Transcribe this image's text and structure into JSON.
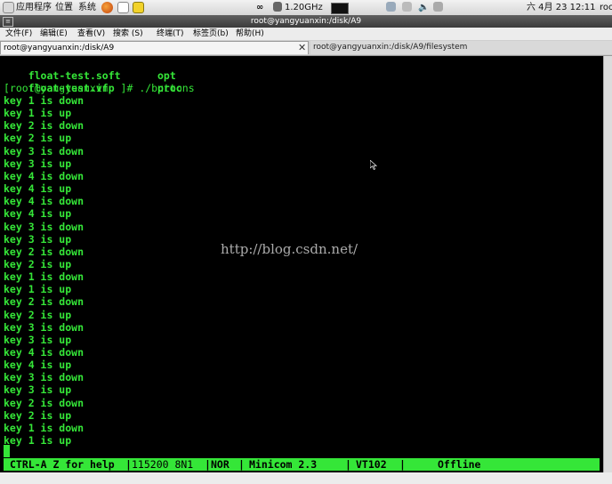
{
  "topbar": {
    "apps": "应用程序",
    "places": "位置",
    "system": "系统",
    "cpu_freq": "1.20GHz",
    "datetime": "六 4月 23 12:11",
    "user": "roo"
  },
  "window": {
    "title": "root@yangyuanxin:/disk/A9"
  },
  "menu": {
    "file": "文件(F)",
    "edit": "编辑(E)",
    "view": "查看(V)",
    "search": "搜索 (S)",
    "terminal": "终端(T)",
    "tabs": "标签页(b)",
    "help": "帮助(H)"
  },
  "tabs": [
    {
      "label": "root@yangyuanxin:/disk/A9"
    },
    {
      "label": "root@yangyuanxin:/disk/A9/filesystem"
    }
  ],
  "terminal": {
    "listing": [
      {
        "name": "float-test.soft",
        "name2": "opt"
      },
      {
        "name": "float-test.vfp",
        "name2": "proc"
      }
    ],
    "prompt": "[root@yangyuanxin  ]# ./buttons",
    "output": [
      "key 1 is down",
      "key 1 is up",
      "key 2 is down",
      "key 2 is up",
      "key 3 is down",
      "key 3 is up",
      "key 4 is down",
      "key 4 is up",
      "key 4 is down",
      "key 4 is up",
      "key 3 is down",
      "key 3 is up",
      "key 2 is down",
      "key 2 is up",
      "key 1 is down",
      "key 1 is up",
      "key 2 is down",
      "key 2 is up",
      "key 3 is down",
      "key 3 is up",
      "key 4 is down",
      "key 4 is up",
      "key 3 is down",
      "key 3 is up",
      "key 2 is down",
      "key 2 is up",
      "key 1 is down",
      "key 1 is up"
    ],
    "watermark": "http://blog.csdn.net/"
  },
  "minicom": {
    "help": "CTRL-A Z for help",
    "baud": "115200 8N1",
    "mode": "NOR",
    "version": "Minicom 2.3",
    "term": "VT102",
    "status": "Offline"
  },
  "colors": {
    "terminal_fg": "#35e638",
    "terminal_bg": "#000000"
  }
}
